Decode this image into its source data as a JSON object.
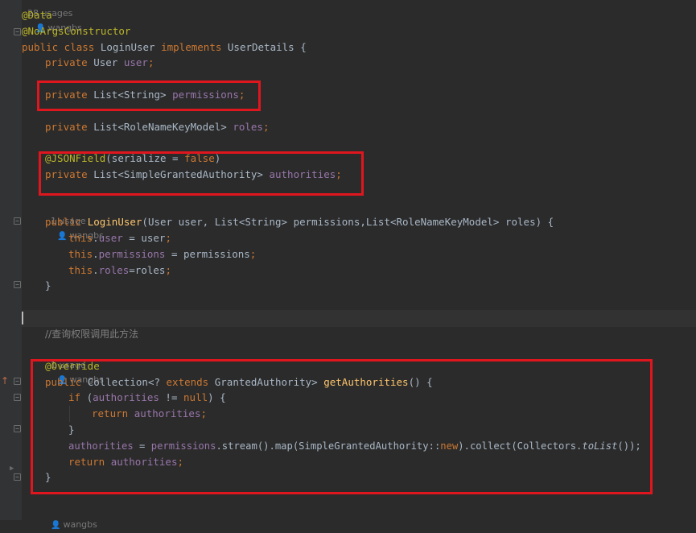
{
  "editor": {
    "top_usage": {
      "usages": "28 usages",
      "author": "wangbs"
    },
    "lines": {
      "ann_data": "@Data",
      "ann_noargs": "@NoArgsConstructor",
      "class_decl": {
        "kw1": "public class ",
        "name": "LoginUser ",
        "kw2": "implements ",
        "iface": "UserDetails {"
      },
      "field_user": {
        "kw": "private ",
        "type": "User ",
        "name": "user",
        "end": ";"
      },
      "field_permissions": {
        "kw": "private ",
        "type": "List<String> ",
        "name": "permissions",
        "end": ";"
      },
      "field_roles": {
        "kw": "private ",
        "type": "List<RoleNameKeyModel> ",
        "name": "roles",
        "end": ";"
      },
      "ann_jsonfield": {
        "ann": "@JSONField",
        "open": "(serialize = ",
        "val": "false",
        "close": ")"
      },
      "field_authorities": {
        "kw": "private ",
        "type": "List<SimpleGrantedAuthority> ",
        "name": "authorities",
        "end": ";"
      },
      "ctor_decl": {
        "kw": "public ",
        "name": "LoginUser",
        "params": "(User user, List<String> permissions,List<RoleNameKeyModel> roles) {"
      },
      "ctor_user": {
        "kw": "this",
        "dot": ".",
        "name": "user",
        "rest": " = user",
        "end": ";"
      },
      "ctor_perm": {
        "kw": "this",
        "dot": ".",
        "name": "permissions",
        "rest": " = permissions",
        "end": ";"
      },
      "ctor_roles": {
        "kw": "this",
        "dot": ".",
        "name": "roles",
        "rest": "=roles",
        "end": ";"
      },
      "ctor_close": "}",
      "comment": "//查询权限调用此方法",
      "ann_override": "@Override",
      "method_decl": {
        "kw1": "public ",
        "type1": "Collection<? ",
        "kw2": "extends ",
        "type2": "GrantedAuthority> ",
        "name": "getAuthorities",
        "rest": "() {"
      },
      "if_line": {
        "kw": "if ",
        "open": "(",
        "name": "authorities",
        "op": " != ",
        "val": "null",
        "close": ") {"
      },
      "return_inner": {
        "kw": "return ",
        "name": "authorities",
        "end": ";"
      },
      "if_close": "}",
      "assign_line": {
        "name": "authorities",
        "eq": " = ",
        "perm": "permissions",
        "mid": ".stream().map(SimpleGrantedAuthority::",
        "kw": "new",
        "mid2": ").collect(Collectors.",
        "italic": "toList",
        "end": "());"
      },
      "return_outer": {
        "kw": "return ",
        "name": "authorities",
        "end": ";"
      },
      "method_close": "}"
    },
    "ctor_usage": {
      "usages": "1 usage",
      "author": "wangbs"
    },
    "method_usage": {
      "usages": "1 usage",
      "author": "wangbs"
    },
    "bottom_usage": {
      "author": "wangbs"
    }
  },
  "highlight_color": "#e0161f"
}
